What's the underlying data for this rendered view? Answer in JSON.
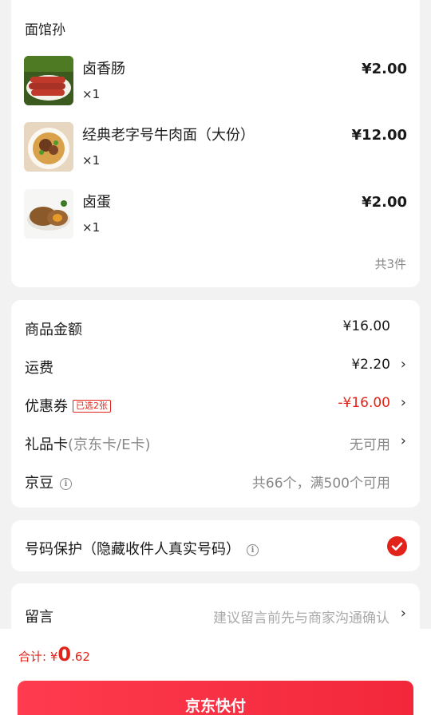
{
  "shop": {
    "name": "面馆孙",
    "items": [
      {
        "name": "卤香肠",
        "qty": "×1",
        "price": "¥2.00",
        "icon": "sausage-image"
      },
      {
        "name": "经典老字号牛肉面（大份）",
        "qty": "×1",
        "price": "¥12.00",
        "icon": "beef-noodle-image"
      },
      {
        "name": "卤蛋",
        "qty": "×1",
        "price": "¥2.00",
        "icon": "braised-egg-image"
      }
    ],
    "count": "共3件"
  },
  "summary": {
    "goods_label": "商品金额",
    "goods_value": "¥16.00",
    "shipping_label": "运费",
    "shipping_value": "¥2.20",
    "coupon_label": "优惠券",
    "coupon_tag": "已选2张",
    "coupon_value": "-¥16.00",
    "giftcard_label": "礼品卡",
    "giftcard_sublabel": "(京东卡/E卡)",
    "giftcard_value": "无可用",
    "beans_label": "京豆",
    "beans_value": "共66个，满500个可用",
    "chevron": "›",
    "info_glyph": "i"
  },
  "protect": {
    "label": "号码保护（隐藏收件人真实号码）",
    "checked": true
  },
  "message": {
    "label": "留言",
    "placeholder": "建议留言前先与商家沟通确认"
  },
  "footer": {
    "total_label": "合计: ",
    "currency": "¥",
    "total_int": "0",
    "total_dec": ".62",
    "pay_label": "京东快付"
  },
  "colors": {
    "accent": "#e2231a",
    "button": "#f2273a",
    "background": "#f2f2f2"
  }
}
